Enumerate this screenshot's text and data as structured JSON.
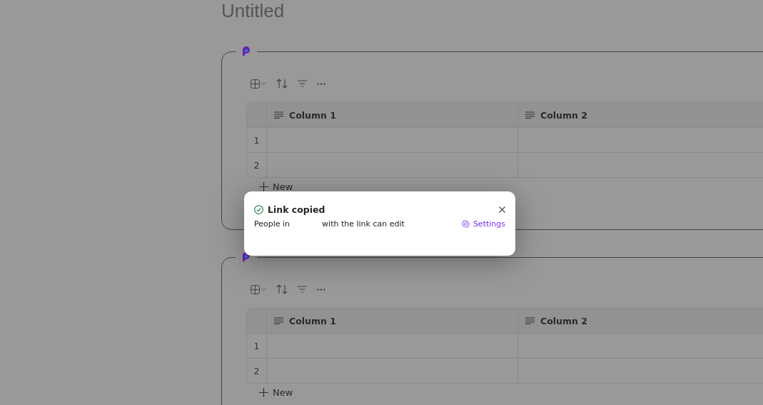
{
  "document": {
    "title": "Untitled"
  },
  "components": [
    {
      "columns": [
        "Column 1",
        "Column 2"
      ],
      "rows": [
        "1",
        "2"
      ],
      "new_label": "New"
    },
    {
      "columns": [
        "Column 1",
        "Column 2"
      ],
      "rows": [
        "1",
        "2"
      ],
      "new_label": "New"
    }
  ],
  "toast": {
    "title": "Link copied",
    "message_start": "People in",
    "message_end": "with the link can edit",
    "settings_link": "Settings"
  }
}
